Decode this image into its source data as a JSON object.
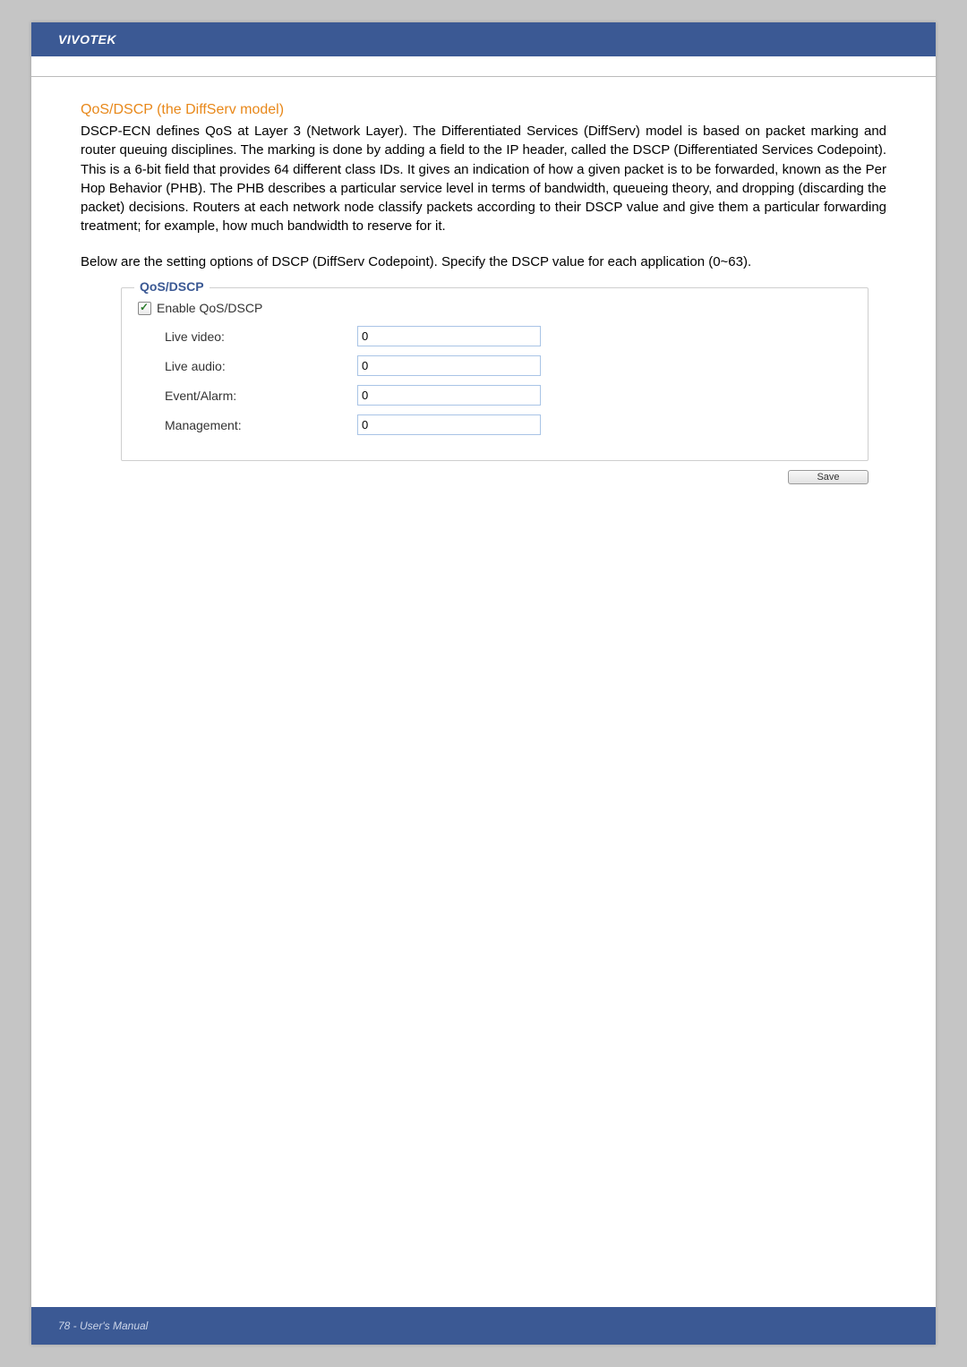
{
  "header": {
    "brand": "VIVOTEK"
  },
  "section": {
    "heading": "QoS/DSCP (the DiffServ model)",
    "paragraph1": "DSCP-ECN defines QoS at Layer 3 (Network Layer). The Differentiated Services (DiffServ) model is based on packet marking and router queuing disciplines. The marking is done by adding a field to the IP header, called the DSCP (Differentiated Services Codepoint). This is a 6-bit field that provides 64 different class IDs. It gives an indication of how a given packet is to be forwarded, known as the Per Hop Behavior (PHB). The PHB describes a particular service level in terms of bandwidth, queueing theory, and dropping (discarding the packet) decisions. Routers at each network node classify packets according to their DSCP value and give them a particular forwarding treatment; for example, how much bandwidth to reserve for it.",
    "paragraph2": "Below are the setting options of DSCP (DiffServ Codepoint). Specify the DSCP value for each application (0~63)."
  },
  "form": {
    "legend": "QoS/DSCP",
    "enable_label": "Enable QoS/DSCP",
    "rows": [
      {
        "label": "Live video:",
        "value": "0"
      },
      {
        "label": "Live audio:",
        "value": "0"
      },
      {
        "label": "Event/Alarm:",
        "value": "0"
      },
      {
        "label": "Management:",
        "value": "0"
      }
    ],
    "save_label": "Save"
  },
  "footer": {
    "text": "78 - User's Manual"
  }
}
